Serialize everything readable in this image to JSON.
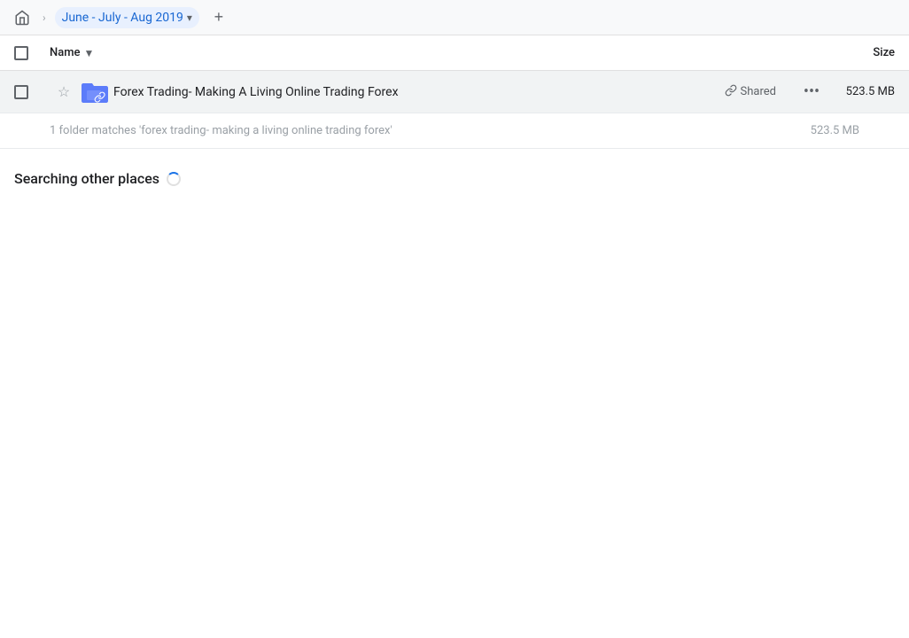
{
  "topbar": {
    "home_icon": "⌂",
    "separator": "›",
    "breadcrumb_label": "June - July - Aug 2019",
    "add_tab_label": "+"
  },
  "columns": {
    "name_label": "Name",
    "name_arrow": "▼",
    "size_label": "Size"
  },
  "file_row": {
    "star_icon": "☆",
    "file_name": "Forex Trading- Making A Living Online Trading Forex",
    "shared_label": "Shared",
    "link_icon": "🔗",
    "more_icon": "⋯",
    "file_size": "523.5 MB"
  },
  "search_info": {
    "text": "1 folder matches 'forex trading- making a living online trading forex'",
    "size": "523.5 MB"
  },
  "other_places": {
    "title": "Searching other places"
  }
}
